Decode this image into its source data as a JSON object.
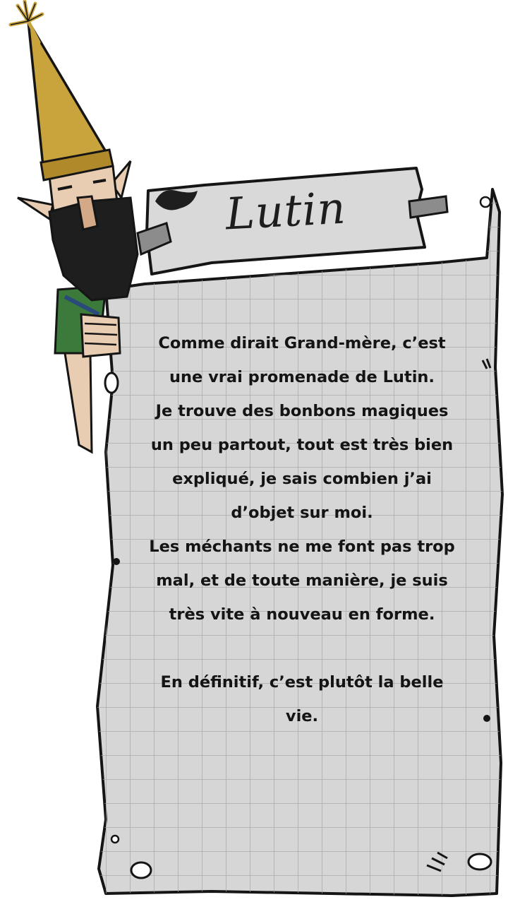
{
  "card": {
    "title": "Lutin",
    "text_lines": [
      "Comme dirait Grand-mère, c’est",
      "une vrai promenade de Lutin.",
      "Je trouve des bonbons magiques",
      "un peu partout, tout est très bien",
      "expliqué, je sais combien j’ai",
      "d’objet sur moi.",
      "Les méchants ne me font pas trop",
      "mal, et de toute manière, je suis",
      "très vite à nouveau en forme."
    ],
    "closing_lines": [
      "En définitif, c’est plutôt la belle",
      "vie."
    ]
  },
  "character": {
    "name": "gnome-character"
  },
  "colors": {
    "paper": "#d9d9d9",
    "grid": "#9a9a9a",
    "outline": "#151515",
    "hat": "#c9a33b",
    "skin": "#e8cdb3",
    "beard": "#1e1e1e",
    "tunic": "#3b7a3a",
    "tape": "#8c8c8c"
  }
}
